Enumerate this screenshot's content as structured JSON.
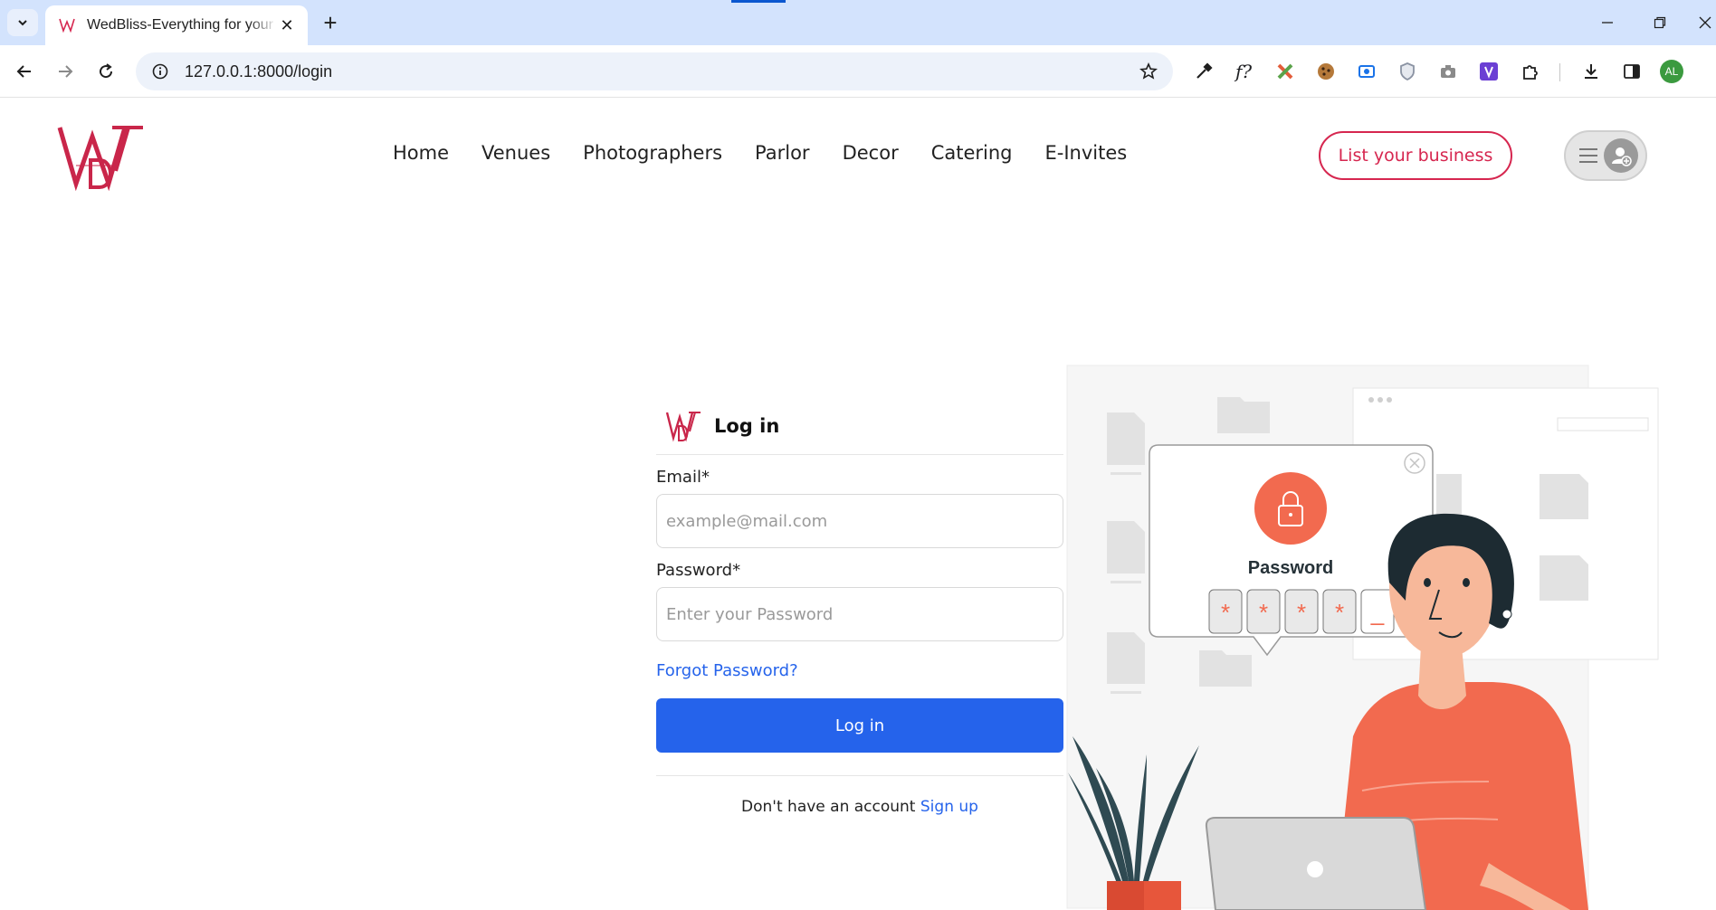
{
  "browser": {
    "tab_title": "WedBliss-Everything for your wedding",
    "url": "127.0.0.1:8000/login",
    "profile_initials": "AL"
  },
  "site": {
    "nav": [
      "Home",
      "Venues",
      "Photographers",
      "Parlor",
      "Decor",
      "Catering",
      "E-Invites"
    ],
    "list_business": "List your business",
    "brand_color": "#d6264f"
  },
  "login": {
    "title": "Log in",
    "email_label": "Email*",
    "email_placeholder": "example@mail.com",
    "password_label": "Password*",
    "password_placeholder": "Enter your Password",
    "forgot": "Forgot Password?",
    "submit": "Log in",
    "no_account": "Don't have an account",
    "signup": "Sign up",
    "accent_color": "#2563eb"
  },
  "illustration": {
    "card_title": "Password",
    "pin_chars": [
      "*",
      "*",
      "*",
      "*",
      "_"
    ]
  }
}
